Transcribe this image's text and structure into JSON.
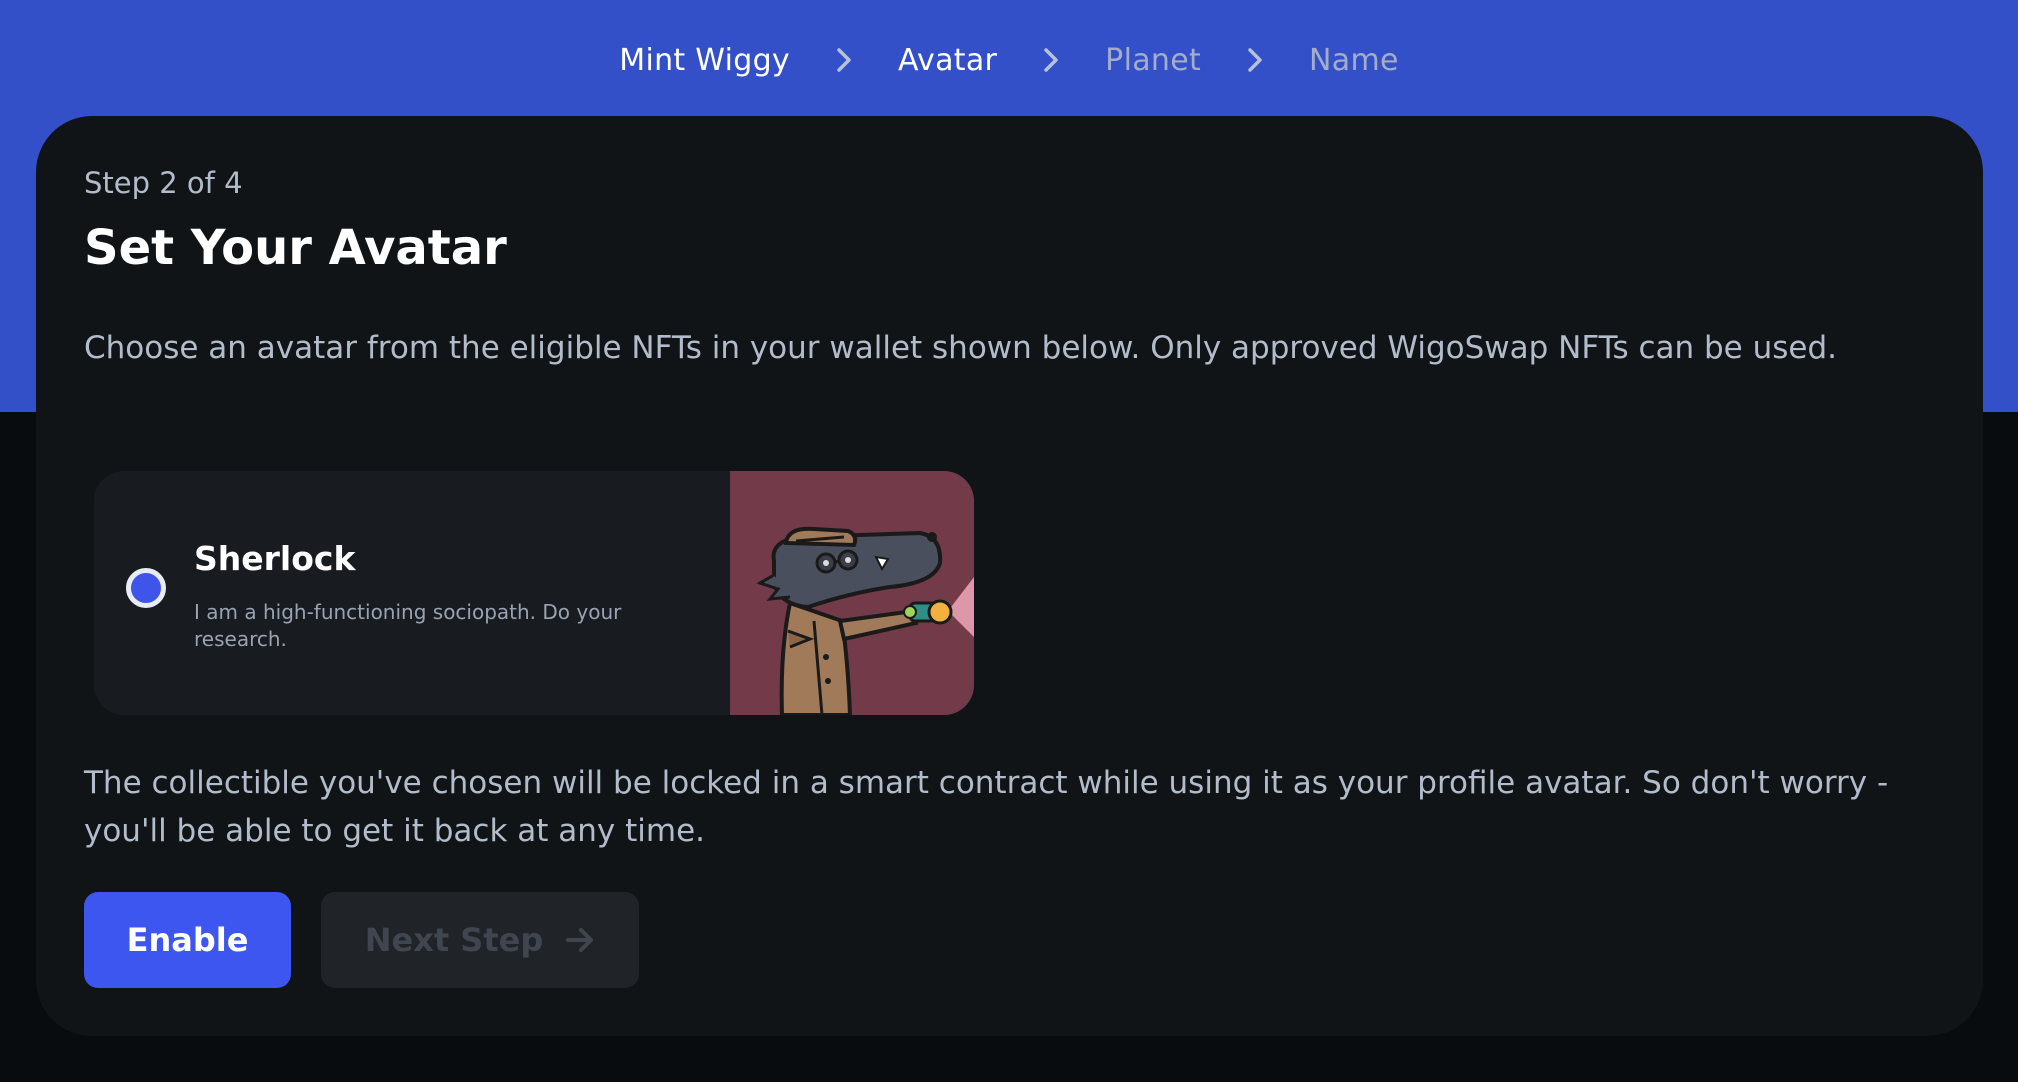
{
  "breadcrumb": {
    "items": [
      {
        "label": "Mint Wiggy",
        "active": true
      },
      {
        "label": "Avatar",
        "active": true
      },
      {
        "label": "Planet",
        "active": false
      },
      {
        "label": "Name",
        "active": false
      }
    ],
    "separator_icon": "chevron-right-icon"
  },
  "step": {
    "label": "Step 2 of 4",
    "title": "Set Your Avatar",
    "description": "Choose an avatar from the eligible NFTs in your wallet shown below. Only approved WigoSwap NFTs can be used."
  },
  "nft_option": {
    "name": "Sherlock",
    "description": "I am a high-functioning sociopath. Do your research.",
    "selected": true
  },
  "note": "The collectible you've chosen will be locked in a smart contract while using it as your profile avatar. So don't worry - you'll be able to get it back at any time.",
  "buttons": {
    "enable_label": "Enable",
    "next_label": "Next Step",
    "next_icon": "arrow-right-icon",
    "next_disabled": true
  },
  "colors": {
    "header_bg": "#3350c8",
    "page_bg": "#080c0e",
    "card_bg": "#101417",
    "accent": "#3d56ef",
    "nft_bg": "#733a49"
  }
}
